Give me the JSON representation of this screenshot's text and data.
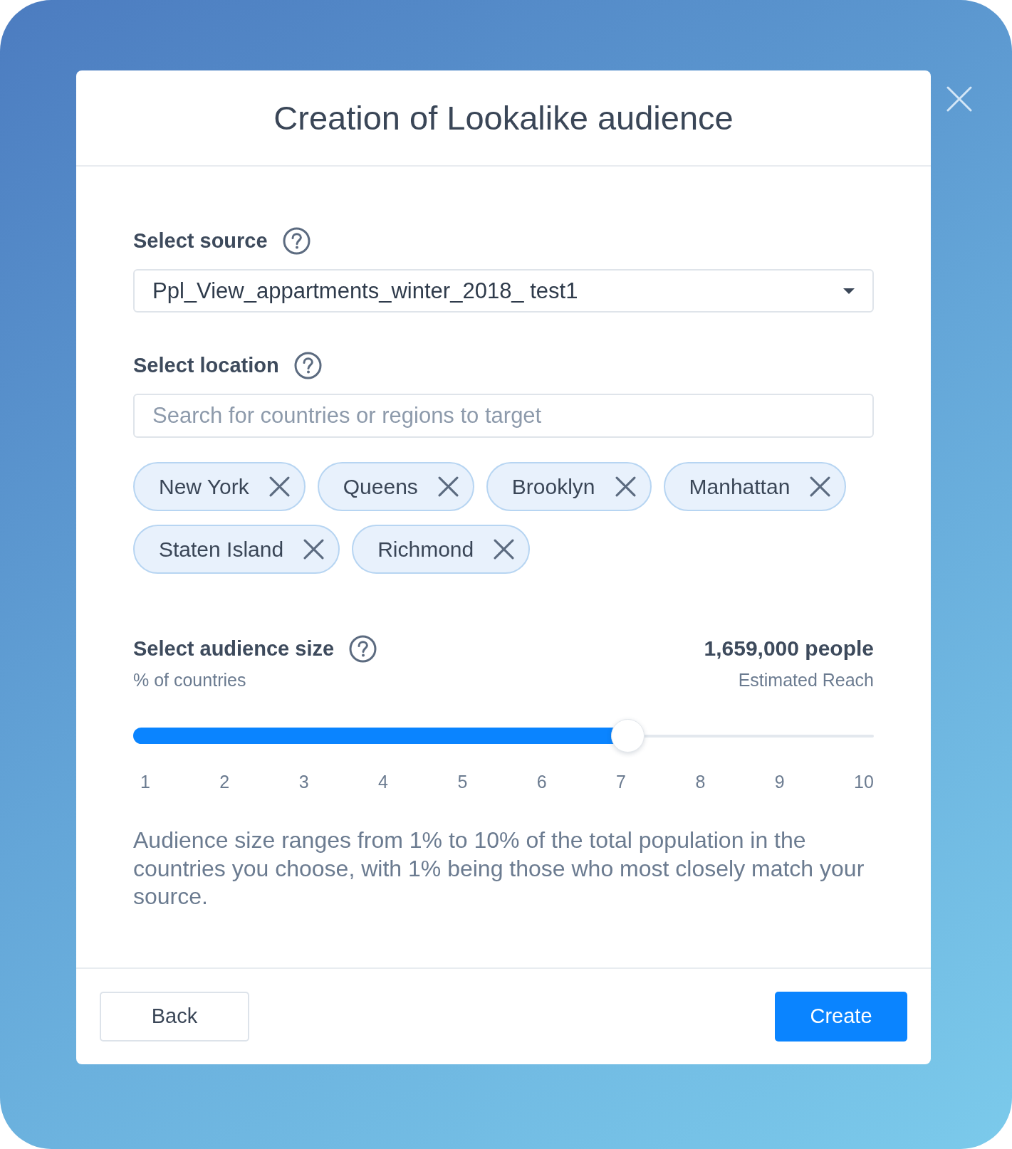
{
  "dialog": {
    "title": "Creation of Lookalike audience"
  },
  "source": {
    "label": "Select source",
    "value": "Ppl_View_appartments_winter_2018_ test1"
  },
  "location": {
    "label": "Select location",
    "placeholder": "Search for countries or regions to target",
    "tags": [
      "New York",
      "Queens",
      "Brooklyn",
      "Manhattan",
      "Staten Island",
      "Richmond"
    ]
  },
  "audience_size": {
    "label": "Select audience size",
    "sublabel": "% of countries",
    "reach": "1,659,000 people",
    "reach_label": "Estimated Reach",
    "slider": {
      "level": 0.667,
      "ticks": [
        "1",
        "2",
        "3",
        "4",
        "5",
        "6",
        "7",
        "8",
        "9",
        "10"
      ]
    },
    "note": "Audience size ranges from 1% to 10% of the total population in the countries you choose, with 1% being those who most closely match your source."
  },
  "buttons": [
    {
      "label": "Back",
      "kind": "secondary"
    },
    {
      "label": "Create",
      "kind": "primary"
    }
  ]
}
